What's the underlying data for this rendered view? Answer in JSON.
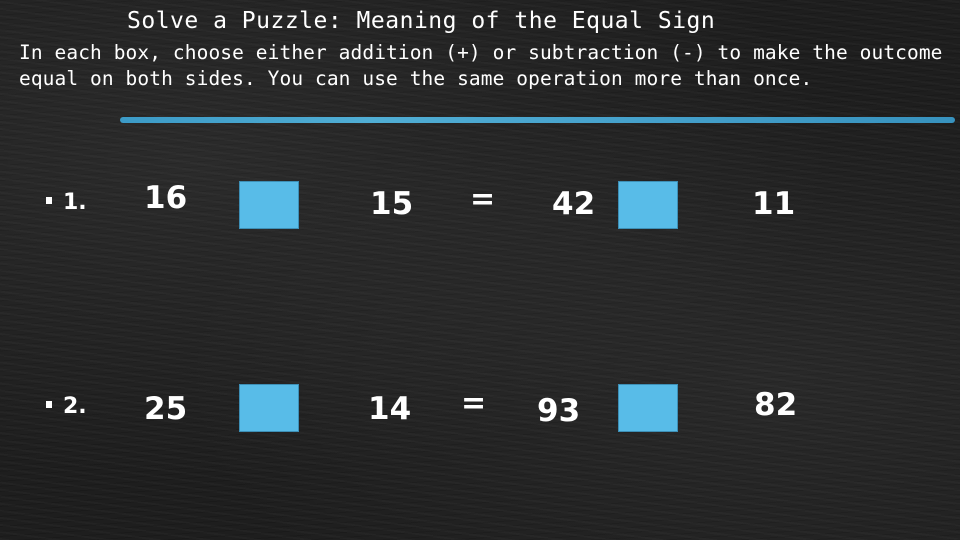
{
  "title": "Solve a Puzzle: Meaning of the Equal Sign",
  "instructions": "In each box, choose either addition (+) or subtraction (-) to make the outcome equal on both sides. You can use the same operation more than once.",
  "colors": {
    "background": "#1e1e1e",
    "accent_underline": "#4ab0df",
    "box_fill": "#58bce8",
    "text": "#ffffff"
  },
  "problems": [
    {
      "label": "1.",
      "left_a": "16",
      "left_b": "15",
      "equals": "=",
      "right_a": "42",
      "right_b": "11"
    },
    {
      "label": "2.",
      "left_a": "25",
      "left_b": "14",
      "equals": "=",
      "right_a": "93",
      "right_b": "82"
    }
  ]
}
